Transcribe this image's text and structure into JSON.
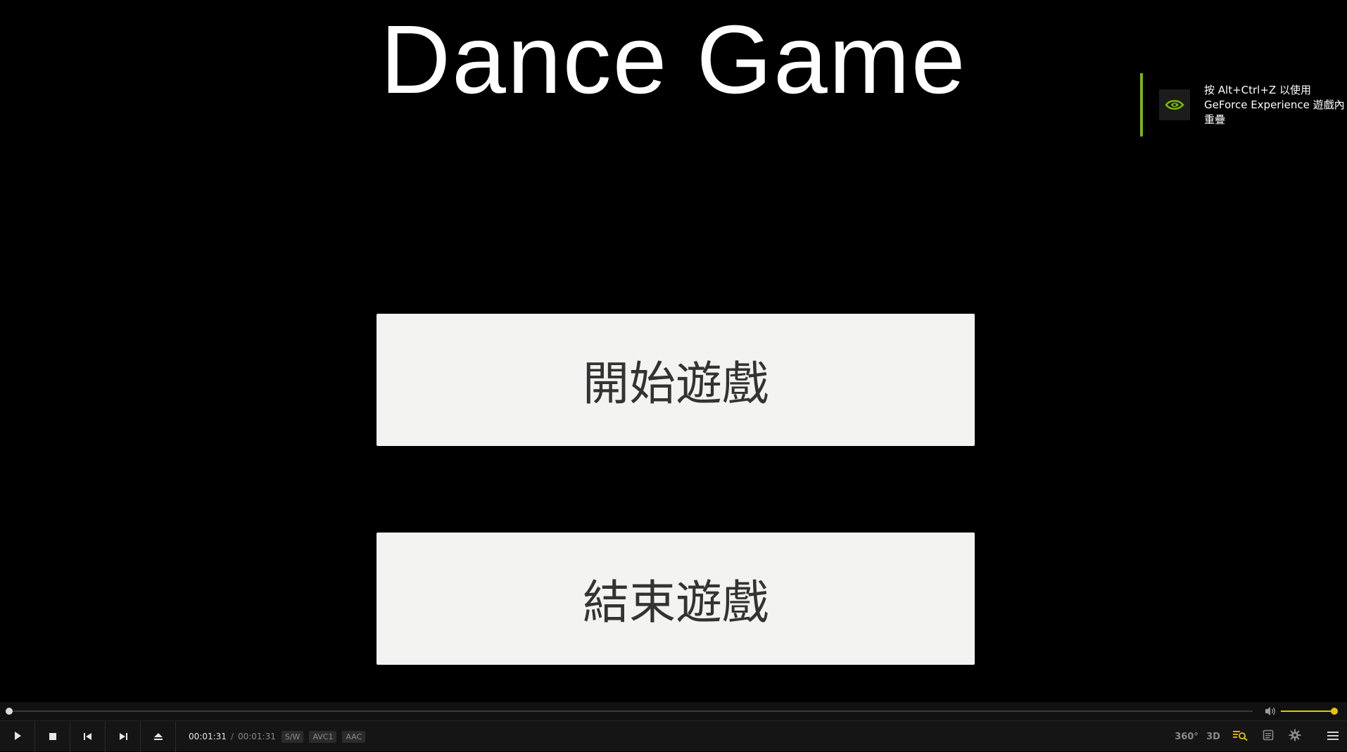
{
  "game": {
    "title": "Dance Game",
    "start_button": "開始遊戲",
    "exit_button": "結束遊戲"
  },
  "overlay_toast": {
    "line1": "按 Alt+Ctrl+Z 以使用",
    "line2": "GeForce Experience 遊戲內",
    "line3": "重疊",
    "accent_color": "#76b900",
    "icon": "nvidia-logo-icon"
  },
  "player": {
    "current_time": "00:01:31",
    "separator": "/",
    "total_time": "00:01:31",
    "badges": [
      "S/W",
      "AVC1",
      "AAC"
    ],
    "seek_progress": 0.0,
    "volume_level": 0.95,
    "accent_color": "#e8c10c",
    "controls": [
      "play-icon",
      "stop-icon",
      "previous-icon",
      "next-icon",
      "eject-icon"
    ],
    "right_controls": {
      "vr_label": "360°",
      "three_d_label": "3D",
      "icons": [
        "playlist-search-icon",
        "subtitles-icon",
        "settings-icon",
        "menu-icon"
      ]
    }
  }
}
